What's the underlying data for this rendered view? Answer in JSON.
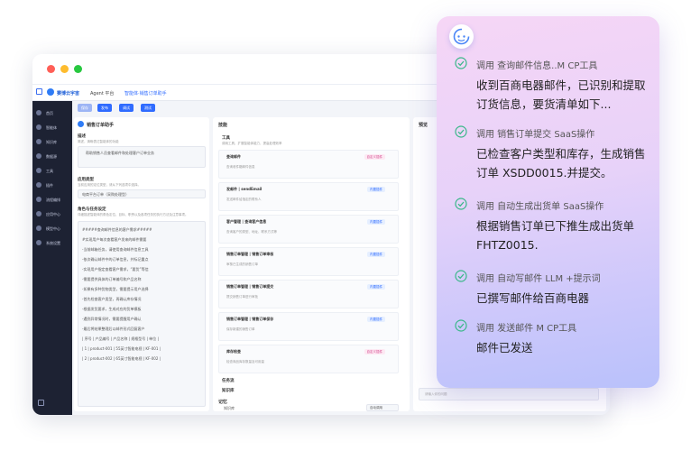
{
  "app": {
    "brand": "赛博云宇宙",
    "nav_agent": "Agent 平台",
    "breadcrumb": "智能体·销售订单助手"
  },
  "toolbar": {
    "buttons": [
      "保存",
      "发布",
      "调试",
      "测试"
    ]
  },
  "sidebar": {
    "items": [
      "首页",
      "智能体",
      "知识库",
      "数据源",
      "工具",
      "插件",
      "流程编排",
      "应用中心",
      "模型中心",
      "系统设置"
    ]
  },
  "left_panel": {
    "title": "销售订单助手",
    "desc_label": "描述",
    "desc_hint": "简述，清晰表达智能体的功能",
    "desc_value": "帮助销售人员查看邮件和处理客户订单业务",
    "type_label": "应用类型",
    "type_hint": "当前应用的定位类型，请从下列选项中选择。",
    "type_value": "电商平台订单（采购处理型）",
    "role_label": "角色与任务设定",
    "role_hint": "详细描述智能体的角色定位、目标、职责以及各项任务的执行方法及注意事项。",
    "role_lines": [
      "#####查询邮件信息的客户需求#####",
      "#实现用户每次查看客户发来的邮件需要",
      "-当前邮箱任务，请使用查询邮件信息工具",
      "-依次确认邮件中的订单信息，并标记重点",
      "-实现用户指定查看客户需求，“要货”等信",
      "-需要提供具体的订单编号和产品名称",
      "-如果有多种货物类型，需要提示用户选择",
      "-首先检查客户类型，再确认库存情况",
      "-根据发货要求，生成对应的货单模板",
      "-遇到异常情况时，需要提醒用户确认",
      "-最后将结果整理后以邮件形式回复客户",
      "| 序号 | 产品编号 | 产品名称 | 规格型号 | 单位 |",
      "| 1 | product-001 | 55英寸智能电视 | KF-001 |",
      "| 2 | product-002 | 65英寸智能电视 | KF-002 |"
    ]
  },
  "middle_panel": {
    "title": "技能",
    "tools_label": "工具",
    "tools_hint": "调用工具，扩展智能体能力，提高处理效率",
    "tools": [
      {
        "name": "查询邮件",
        "tag": "自定义插件",
        "desc": "查询收件箱邮件信息"
      },
      {
        "name": "发邮件 | sendEmail",
        "tag": "内置插件",
        "desc": "发送邮件给指定的联系人"
      },
      {
        "name": "客户管理 | 查询客户信息",
        "tag": "内置插件",
        "desc": "查询客户的类型、地址、联系方式等"
      },
      {
        "name": "销售订单管理 | 销售订单审核",
        "tag": "内置插件",
        "desc": "审核已生成的销售订单"
      },
      {
        "name": "销售订单管理 | 销售订单提交",
        "tag": "内置插件",
        "desc": "提交销售订单进行审批"
      },
      {
        "name": "销售订单管理 | 销售订单保存",
        "tag": "内置插件",
        "desc": "保存新建的销售订单"
      },
      {
        "name": "库存检查",
        "tag": "自定义插件",
        "desc": "检查商品库存数量及可用量"
      }
    ],
    "collapsed": [
      "任务流",
      "知识库"
    ],
    "memory_label": "记忆",
    "memory_item": "知识库",
    "memory_select": "自动调用"
  },
  "preview_panel": {
    "title": "预览",
    "input_placeholder": "请输入你的问题"
  },
  "chat": {
    "steps": [
      {
        "label": "调用 查询邮件信息..M CP工具",
        "body": "收到百商电器邮件，已识别和提取订货信息，要货清单如下..."
      },
      {
        "label": "调用 销售订单提交 SaaS操作",
        "body": "已检查客户类型和库存，生成销售订单 XSDD0015.并提交。"
      },
      {
        "label": "调用 自动生成出货单 SaaS操作",
        "body": "根据销售订单已下推生成出货单FHTZ0015."
      },
      {
        "label": "调用 自动写邮件 LLM +提示词",
        "body": "已撰写邮件给百商电器"
      },
      {
        "label": "调用 发送邮件 M CP工具",
        "body": "邮件已发送"
      }
    ],
    "colors": {
      "check": "#3bb88a",
      "accent": "#2f6bff"
    }
  }
}
